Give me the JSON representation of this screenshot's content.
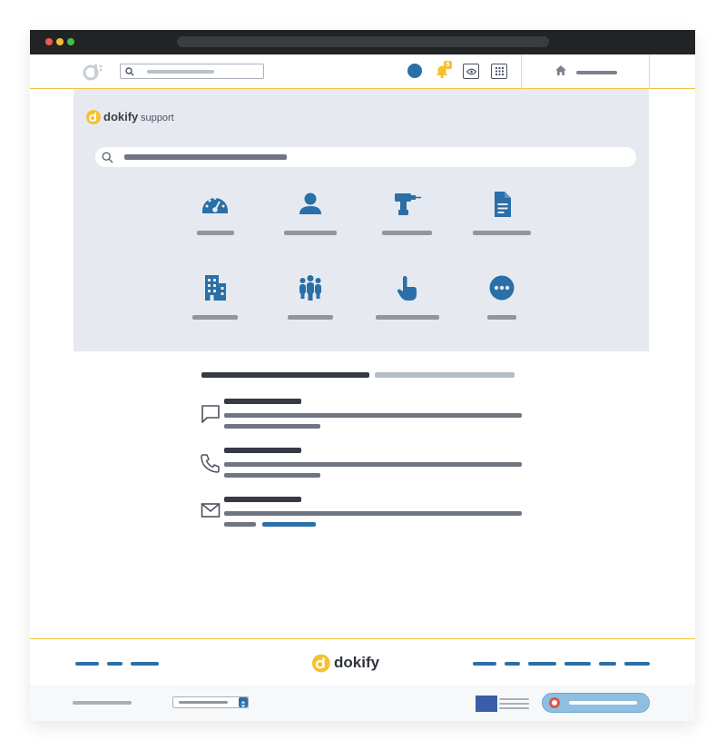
{
  "brand": {
    "name": "dokify",
    "section": "support",
    "accent_color": "#f5c12e",
    "primary_color": "#2a6fa8"
  },
  "topnav": {
    "notification_count": "5",
    "icons": [
      "search-icon",
      "bell-icon",
      "eye-icon",
      "grid-icon",
      "home-icon"
    ]
  },
  "categories": [
    {
      "icon": "dashboard-icon"
    },
    {
      "icon": "user-icon"
    },
    {
      "icon": "drill-icon"
    },
    {
      "icon": "document-icon"
    },
    {
      "icon": "building-icon"
    },
    {
      "icon": "group-icon"
    },
    {
      "icon": "pointer-hand-icon"
    },
    {
      "icon": "more-icon"
    }
  ],
  "contact": {
    "methods": [
      {
        "icon": "chat-icon"
      },
      {
        "icon": "phone-icon"
      },
      {
        "icon": "mail-icon"
      }
    ]
  },
  "footer": {
    "logo": "dokify"
  }
}
